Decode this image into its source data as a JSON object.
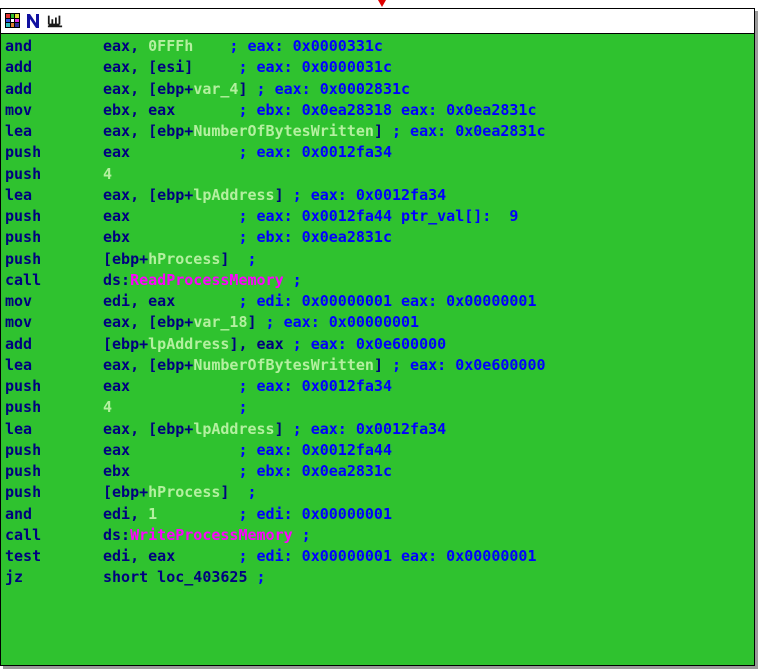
{
  "colors": {
    "background": "#2fc22f",
    "mnemonic": "#000080",
    "comment": "#0000ff",
    "local_var": "#b4f0a0",
    "api": "#ff00ff"
  },
  "toolbar": {
    "icons": [
      "graph-overview-icon",
      "name-icon",
      "flowchart-icon"
    ]
  },
  "instructions": [
    {
      "mn": "and",
      "ops": [
        {
          "t": "eax, ",
          "c": "op"
        },
        {
          "t": "0FFFh",
          "c": "lv"
        }
      ],
      "cmt": "    ; eax: 0x0000331c"
    },
    {
      "mn": "add",
      "ops": [
        {
          "t": "eax, [esi]",
          "c": "op"
        }
      ],
      "cmt": "     ; eax: 0x0000031c"
    },
    {
      "mn": "add",
      "ops": [
        {
          "t": "eax, [ebp+",
          "c": "op"
        },
        {
          "t": "var_4",
          "c": "lv"
        },
        {
          "t": "]",
          "c": "op"
        }
      ],
      "cmt": " ; eax: 0x0002831c"
    },
    {
      "mn": "mov",
      "ops": [
        {
          "t": "ebx, eax",
          "c": "op"
        }
      ],
      "cmt": "       ; ebx: 0x0ea28318 eax: 0x0ea2831c"
    },
    {
      "mn": "lea",
      "ops": [
        {
          "t": "eax, [ebp+",
          "c": "op"
        },
        {
          "t": "NumberOfBytesWritten",
          "c": "lv"
        },
        {
          "t": "]",
          "c": "op"
        }
      ],
      "cmt": " ; eax: 0x0ea2831c"
    },
    {
      "mn": "push",
      "ops": [
        {
          "t": "eax",
          "c": "op"
        }
      ],
      "cmt": "            ; eax: 0x0012fa34"
    },
    {
      "mn": "push",
      "ops": [
        {
          "t": "4",
          "c": "lv"
        }
      ],
      "cmt": ""
    },
    {
      "mn": "lea",
      "ops": [
        {
          "t": "eax, [ebp+",
          "c": "op"
        },
        {
          "t": "lpAddress",
          "c": "lv"
        },
        {
          "t": "]",
          "c": "op"
        }
      ],
      "cmt": " ; eax: 0x0012fa34"
    },
    {
      "mn": "push",
      "ops": [
        {
          "t": "eax",
          "c": "op"
        }
      ],
      "cmt": "            ; eax: 0x0012fa44 ptr_val[]:  9"
    },
    {
      "mn": "push",
      "ops": [
        {
          "t": "ebx",
          "c": "op"
        }
      ],
      "cmt": "            ; ebx: 0x0ea2831c"
    },
    {
      "mn": "push",
      "ops": [
        {
          "t": "[ebp+",
          "c": "op"
        },
        {
          "t": "hProcess",
          "c": "lv"
        },
        {
          "t": "]",
          "c": "op"
        }
      ],
      "cmt": "  ;"
    },
    {
      "mn": "call",
      "ops": [
        {
          "t": "ds:",
          "c": "op"
        },
        {
          "t": "ReadProcessMemory",
          "c": "api"
        }
      ],
      "cmt": " ;"
    },
    {
      "mn": "mov",
      "ops": [
        {
          "t": "edi, eax",
          "c": "op"
        }
      ],
      "cmt": "       ; edi: 0x00000001 eax: 0x00000001"
    },
    {
      "mn": "mov",
      "ops": [
        {
          "t": "eax, [ebp+",
          "c": "op"
        },
        {
          "t": "var_18",
          "c": "lv"
        },
        {
          "t": "]",
          "c": "op"
        }
      ],
      "cmt": " ; eax: 0x00000001"
    },
    {
      "mn": "add",
      "ops": [
        {
          "t": "[ebp+",
          "c": "op"
        },
        {
          "t": "lpAddress",
          "c": "lv"
        },
        {
          "t": "], eax",
          "c": "op"
        }
      ],
      "cmt": " ; eax: 0x0e600000"
    },
    {
      "mn": "lea",
      "ops": [
        {
          "t": "eax, [ebp+",
          "c": "op"
        },
        {
          "t": "NumberOfBytesWritten",
          "c": "lv"
        },
        {
          "t": "]",
          "c": "op"
        }
      ],
      "cmt": " ; eax: 0x0e600000"
    },
    {
      "mn": "push",
      "ops": [
        {
          "t": "eax",
          "c": "op"
        }
      ],
      "cmt": "            ; eax: 0x0012fa34"
    },
    {
      "mn": "push",
      "ops": [
        {
          "t": "4",
          "c": "lv"
        }
      ],
      "cmt": "              ;"
    },
    {
      "mn": "lea",
      "ops": [
        {
          "t": "eax, [ebp+",
          "c": "op"
        },
        {
          "t": "lpAddress",
          "c": "lv"
        },
        {
          "t": "]",
          "c": "op"
        }
      ],
      "cmt": " ; eax: 0x0012fa34"
    },
    {
      "mn": "push",
      "ops": [
        {
          "t": "eax",
          "c": "op"
        }
      ],
      "cmt": "            ; eax: 0x0012fa44"
    },
    {
      "mn": "push",
      "ops": [
        {
          "t": "ebx",
          "c": "op"
        }
      ],
      "cmt": "            ; ebx: 0x0ea2831c"
    },
    {
      "mn": "push",
      "ops": [
        {
          "t": "[ebp+",
          "c": "op"
        },
        {
          "t": "hProcess",
          "c": "lv"
        },
        {
          "t": "]",
          "c": "op"
        }
      ],
      "cmt": "  ;"
    },
    {
      "mn": "and",
      "ops": [
        {
          "t": "edi, ",
          "c": "op"
        },
        {
          "t": "1",
          "c": "lv"
        }
      ],
      "cmt": "         ; edi: 0x00000001"
    },
    {
      "mn": "call",
      "ops": [
        {
          "t": "ds:",
          "c": "op"
        },
        {
          "t": "WriteProcessMemory",
          "c": "api"
        }
      ],
      "cmt": " ;"
    },
    {
      "mn": "test",
      "ops": [
        {
          "t": "edi, eax",
          "c": "op"
        }
      ],
      "cmt": "       ; edi: 0x00000001 eax: 0x00000001"
    },
    {
      "mn": "jz",
      "ops": [
        {
          "t": "short loc_403625",
          "c": "op"
        }
      ],
      "cmt": " ;"
    }
  ]
}
